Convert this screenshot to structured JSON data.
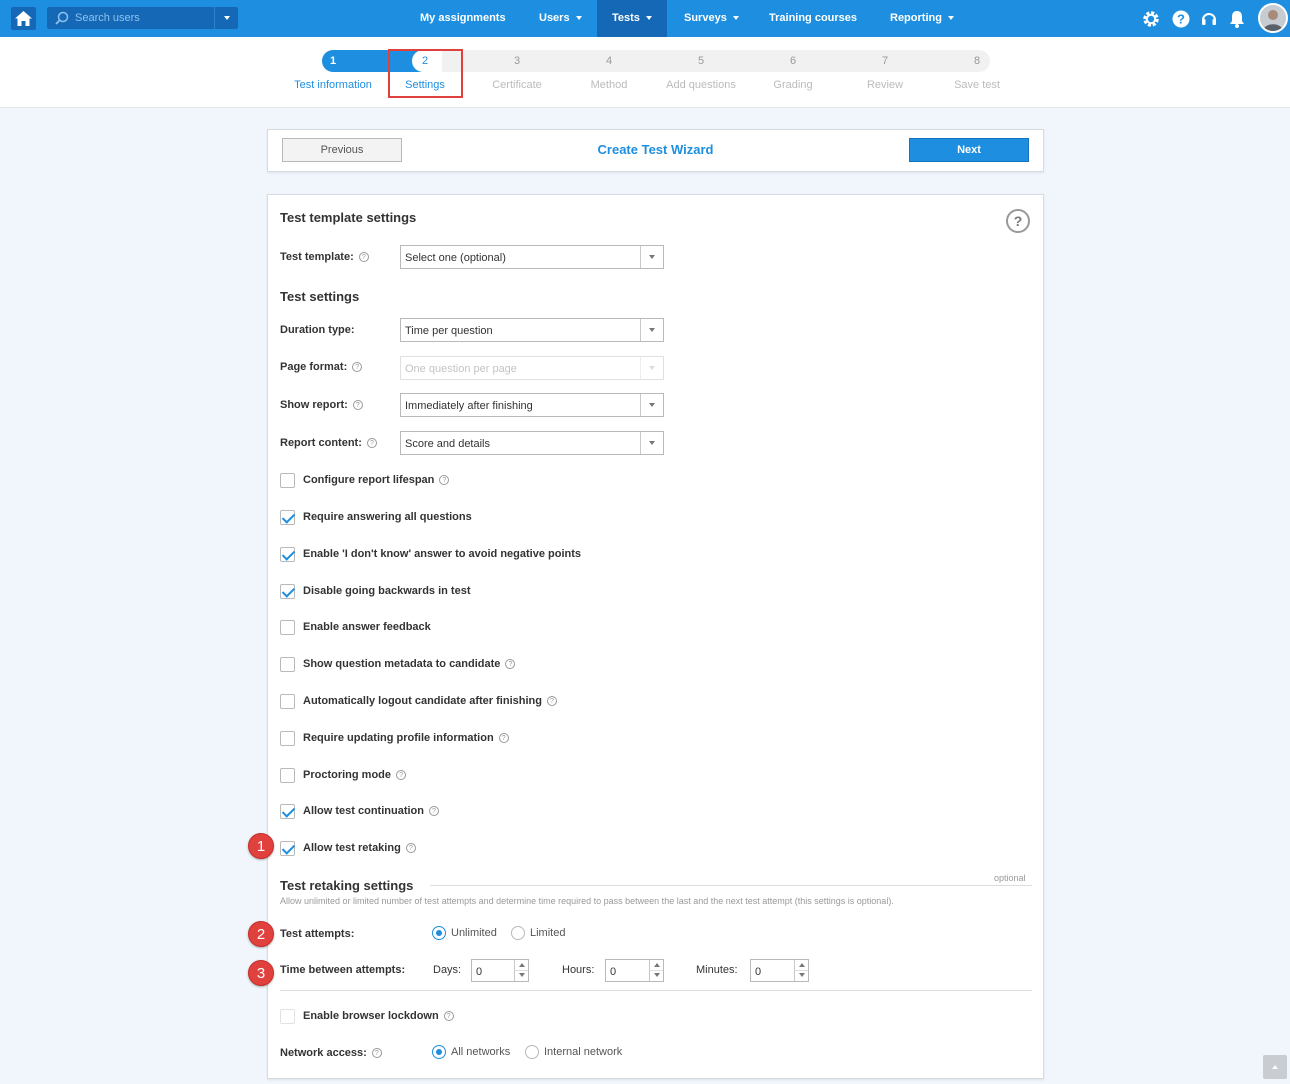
{
  "nav": {
    "search_placeholder": "Search users",
    "items": [
      {
        "label": "My assignments",
        "dropdown": false,
        "active": false
      },
      {
        "label": "Users",
        "dropdown": true,
        "active": false
      },
      {
        "label": "Tests",
        "dropdown": true,
        "active": true
      },
      {
        "label": "Surveys",
        "dropdown": true,
        "active": false
      },
      {
        "label": "Training courses",
        "dropdown": false,
        "active": false
      },
      {
        "label": "Reporting",
        "dropdown": true,
        "active": false
      }
    ],
    "icons": [
      "gear-icon",
      "help-icon",
      "headset-icon",
      "bell-icon"
    ]
  },
  "stepper": {
    "steps": [
      {
        "num": "1",
        "label": "Test information",
        "state": "done"
      },
      {
        "num": "2",
        "label": "Settings",
        "state": "current"
      },
      {
        "num": "3",
        "label": "Certificate",
        "state": "todo"
      },
      {
        "num": "4",
        "label": "Method",
        "state": "todo"
      },
      {
        "num": "5",
        "label": "Add questions",
        "state": "todo"
      },
      {
        "num": "6",
        "label": "Grading",
        "state": "todo"
      },
      {
        "num": "7",
        "label": "Review",
        "state": "todo"
      },
      {
        "num": "8",
        "label": "Save test",
        "state": "todo"
      }
    ]
  },
  "wizard": {
    "prev_label": "Previous",
    "title": "Create Test Wizard",
    "next_label": "Next"
  },
  "template_section": {
    "title": "Test template settings",
    "help_symbol": "?",
    "template_label": "Test template:",
    "template_value": "Select one (optional)"
  },
  "test_settings": {
    "title": "Test settings",
    "duration_label": "Duration type:",
    "duration_value": "Time per question",
    "page_format_label": "Page format:",
    "page_format_value": "One question per page",
    "show_report_label": "Show report:",
    "show_report_value": "Immediately after finishing",
    "report_content_label": "Report content:",
    "report_content_value": "Score and details",
    "options": [
      {
        "label": "Configure report lifespan",
        "checked": false,
        "help": true
      },
      {
        "label": "Require answering all questions",
        "checked": true,
        "help": false
      },
      {
        "label": "Enable 'I don't know' answer to avoid negative points",
        "checked": true,
        "help": false
      },
      {
        "label": "Disable going backwards in test",
        "checked": true,
        "help": false
      },
      {
        "label": "Enable answer feedback",
        "checked": false,
        "help": false
      },
      {
        "label": "Show question metadata to candidate",
        "checked": false,
        "help": true
      },
      {
        "label": "Automatically logout candidate after finishing",
        "checked": false,
        "help": true
      },
      {
        "label": "Require updating profile information",
        "checked": false,
        "help": true
      },
      {
        "label": "Proctoring mode",
        "checked": false,
        "help": true
      },
      {
        "label": "Allow test continuation",
        "checked": true,
        "help": true
      },
      {
        "label": "Allow test retaking",
        "checked": true,
        "help": true
      }
    ]
  },
  "retaking": {
    "title": "Test retaking settings",
    "optional": "optional",
    "description": "Allow unlimited or limited number of test attempts and determine time required to pass between the last and the next test attempt (this settings is optional).",
    "attempts_label": "Test attempts:",
    "attempts_options": [
      "Unlimited",
      "Limited"
    ],
    "attempts_selected": "Unlimited",
    "time_label": "Time between attempts:",
    "days_label": "Days:",
    "days_value": "0",
    "hours_label": "Hours:",
    "hours_value": "0",
    "minutes_label": "Minutes:",
    "minutes_value": "0"
  },
  "lockdown": {
    "label": "Enable browser lockdown",
    "checked": false,
    "network_label": "Network access:",
    "network_options": [
      "All networks",
      "Internal network"
    ],
    "network_selected": "All networks"
  },
  "annotations": [
    "1",
    "2",
    "3"
  ],
  "colors": {
    "brand": "#1e8fe0",
    "nav_active": "#1568b5",
    "annotation": "#e0413d"
  }
}
